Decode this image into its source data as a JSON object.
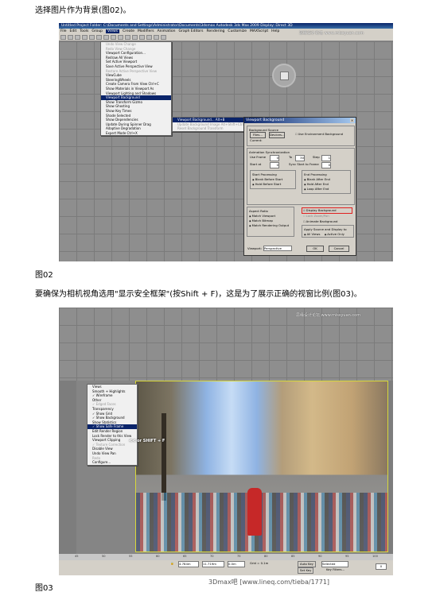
{
  "captions": {
    "intro": "选择图片作为背景(图02)。",
    "fig02": "图02",
    "body": "要确保为相机视角选用\"显示安全框架\"(按Shift + F)，这是为了展示正确的视窗比例(图03)。",
    "fig03": "图03"
  },
  "fig02": {
    "title_bar": "Untitled   Project Folder: C:\\Documents and Settings\\Administrator\\Documents\\3dsmax   Autodesk 3ds Max 2009   Display: Direct 3D",
    "menubar": [
      "File",
      "Edit",
      "Tools",
      "Group",
      "Views",
      "Create",
      "Modifiers",
      "Animation",
      "Graph Editors",
      "Rendering",
      "Customize",
      "MAXScript",
      "Help"
    ],
    "active_menu": "Views",
    "watermark": "思缘设计论坛 www.missyuan.com",
    "views_menu": [
      {
        "label": "Undo View Change",
        "state": "dis"
      },
      {
        "label": "Redo View Change",
        "state": "dis"
      },
      {
        "label": "Viewport Configuration...",
        "state": ""
      },
      {
        "label": "Redraw All Views",
        "state": ""
      },
      {
        "label": "Set Active Viewport",
        "state": ""
      },
      {
        "label": "Save Active Perspective View",
        "state": ""
      },
      {
        "label": "Restore Active Perspective View",
        "state": "dis"
      },
      {
        "label": "ViewCube",
        "state": ""
      },
      {
        "label": "SteeringWheels",
        "state": ""
      },
      {
        "label": "Create Camera From View     Ctrl+C",
        "state": ""
      },
      {
        "label": "Show Materials in Viewport As",
        "state": ""
      },
      {
        "label": "Viewport Lighting and Shadows",
        "state": ""
      },
      {
        "label": "Viewport Background",
        "state": "hl"
      },
      {
        "label": "Show Transform Gizmo",
        "state": ""
      },
      {
        "label": "Show Ghosting",
        "state": ""
      },
      {
        "label": "Show Key Times",
        "state": ""
      },
      {
        "label": "Shade Selected",
        "state": ""
      },
      {
        "label": "Show Dependencies",
        "state": ""
      },
      {
        "label": "Update During Spinner Drag",
        "state": ""
      },
      {
        "label": "Adaptive Degradation",
        "state": ""
      },
      {
        "label": "Expert Mode     Ctrl+X",
        "state": ""
      }
    ],
    "submenu": [
      {
        "label": "Viewport Background...     Alt+B",
        "state": "hl"
      },
      {
        "label": "Update Background Image     Alt+Shift+Ctrl+B",
        "state": "dis"
      },
      {
        "label": "Reset Background Transform",
        "state": "dis"
      }
    ],
    "dialog": {
      "title": "Viewport Background",
      "bg_source": "Background Source",
      "files_btn": "Files...",
      "devices_btn": "Devices...",
      "use_env": "Use Environment Background",
      "current": "Current:",
      "anim_sync": "Animation Synchronization",
      "use_frame": "Use Frame",
      "use_frame_val": "0",
      "to": "To",
      "to_val": "30",
      "step": "Step",
      "step_val": "1",
      "start_at": "Start at",
      "start_at_val": "0",
      "sync_start": "Sync Start to Frame",
      "sync_start_val": "0",
      "start_proc": "Start Processing",
      "blank_before": "Blank Before Start",
      "hold_before": "Hold Before Start",
      "end_proc": "End Processing",
      "blank_after": "Blank After End",
      "hold_after": "Hold After End",
      "loop_after": "Loop After End",
      "aspect": "Aspect Ratio",
      "match_viewport": "Match Viewport",
      "match_bitmap": "Match Bitmap",
      "match_render": "Match Rendering Output",
      "display_bg": "Display Background",
      "lock_zoom": "Lock Zoom/Pan",
      "animate_bg": "Animate Background",
      "apply_src": "Apply Source and Display to",
      "all_views": "All Views",
      "active_only": "Active Only",
      "viewport_label": "Viewport:",
      "viewport_val": "Perspective",
      "ok": "OK",
      "cancel": "Cancel"
    }
  },
  "fig03": {
    "watermark": "思缘设计论坛 www.missyuan.com",
    "ctx_menu": [
      {
        "label": "Views",
        "state": ""
      },
      {
        "label": "Smooth + Highlights",
        "state": ""
      },
      {
        "label": "✓ Wireframe",
        "state": ""
      },
      {
        "label": "Other",
        "state": ""
      },
      {
        "label": "✓ Edged Faces",
        "state": "dis"
      },
      {
        "label": "Transparency",
        "state": ""
      },
      {
        "label": "✓ Show Grid",
        "state": ""
      },
      {
        "label": "✓ Show Background",
        "state": ""
      },
      {
        "label": "Show Statistics",
        "state": ""
      },
      {
        "label": "✓ Show Safe Frame",
        "state": "hl"
      },
      {
        "label": "Edit Render Region",
        "state": ""
      },
      {
        "label": "Lock Render to this View",
        "state": ""
      },
      {
        "label": "Viewport Clipping",
        "state": ""
      },
      {
        "label": "✓ Texture Correction",
        "state": "dis"
      },
      {
        "label": "Disable View",
        "state": ""
      },
      {
        "label": "Undo View Pan",
        "state": ""
      },
      {
        "label": "Redo",
        "state": "dis"
      },
      {
        "label": "Configure...",
        "state": ""
      }
    ],
    "shortcut_tip": "<< or SHIFT + F",
    "ruler_ticks": [
      "45",
      "50",
      "55",
      "60",
      "65",
      "70",
      "75",
      "80",
      "85",
      "90",
      "95",
      "100"
    ],
    "status": {
      "x": "4.784m",
      "y": "11.719m",
      "z": "0.0m",
      "grid": "Grid = 0.1m",
      "autokey": "Auto Key",
      "selected": "Selected",
      "setkey": "Set Key",
      "keyfilters": "Key Filters...",
      "frame": "0"
    }
  },
  "footer_watermark": "3Dmax吧 [www.lineq.com/tieba/1771]"
}
